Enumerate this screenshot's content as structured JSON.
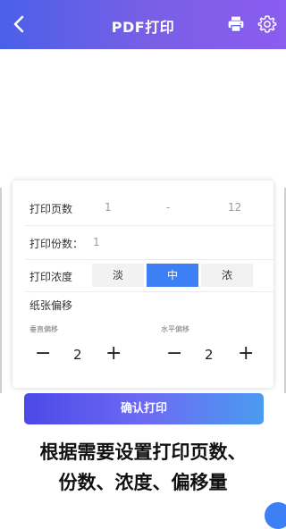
{
  "header": {
    "title": "PDF打印"
  },
  "pages": {
    "label": "打印页数",
    "from": "1",
    "sep": "-",
    "to": "12"
  },
  "copies": {
    "label": "打印份数：",
    "value": "1"
  },
  "density": {
    "label": "打印浓度",
    "options": [
      "淡",
      "中",
      "浓"
    ],
    "selected": "中"
  },
  "offset": {
    "label": "纸张偏移",
    "vertical": {
      "label": "垂直偏移",
      "minus": "−",
      "value": "2",
      "plus": "+"
    },
    "horizontal": {
      "label": "水平偏移",
      "minus": "−",
      "value": "2",
      "plus": "+"
    }
  },
  "confirm_label": "确认打印",
  "caption": {
    "line1": "根据需要设置打印页数、",
    "line2": "份数、浓度、偏移量"
  },
  "colors": {
    "accent": "#3d7ff5",
    "header_start": "#4a60e8",
    "header_end": "#8b5cf0"
  }
}
